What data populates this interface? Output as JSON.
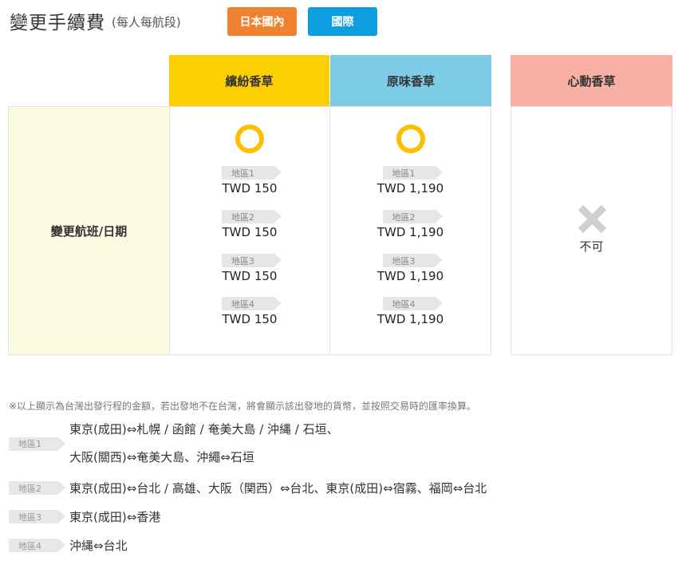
{
  "header": {
    "title": "變更手續費",
    "subtitle": "(每人每航段)",
    "tabs": [
      {
        "label": "日本國內",
        "color": "#f0812f"
      },
      {
        "label": "國際",
        "color": "#0e9ee0"
      }
    ]
  },
  "table": {
    "columns": [
      {
        "label": "繽紛香草",
        "color": "#fccf00"
      },
      {
        "label": "原味香草",
        "color": "#7dcbe6"
      },
      {
        "label": "心動香草",
        "color": "#f9b0a4"
      }
    ],
    "row_label": "變更航班/日期",
    "col1": {
      "icon": "circle-icon",
      "prices": [
        {
          "zone": "地區1",
          "value": "TWD 150"
        },
        {
          "zone": "地區2",
          "value": "TWD 150"
        },
        {
          "zone": "地區3",
          "value": "TWD 150"
        },
        {
          "zone": "地區4",
          "value": "TWD 150"
        }
      ]
    },
    "col2": {
      "icon": "circle-icon",
      "prices": [
        {
          "zone": "地區1",
          "value": "TWD 1,190"
        },
        {
          "zone": "地區2",
          "value": "TWD 1,190"
        },
        {
          "zone": "地區3",
          "value": "TWD 1,190"
        },
        {
          "zone": "地區4",
          "value": "TWD 1,190"
        }
      ]
    },
    "col3": {
      "icon": "x-icon",
      "text": "不可"
    }
  },
  "note": "※以上顯示為台灣出發行程的金額，若出發地不在台灣，將會顯示該出發地的貨幣，並按照交易時的匯率換算。",
  "legend": [
    {
      "zone": "地區1",
      "lines": [
        "東京(成田)⇔札幌 / 函館 / 奄美大島 / 沖縄 / 石垣、",
        "大阪(關西)⇔奄美大島、沖繩⇔石垣"
      ]
    },
    {
      "zone": "地區2",
      "lines": [
        "東京(成田)⇔台北 / 高雄、大阪（関西）⇔台北、東京(成田)⇔宿霧、福岡⇔台北"
      ]
    },
    {
      "zone": "地區3",
      "lines": [
        "東京(成田)⇔香港"
      ]
    },
    {
      "zone": "地區4",
      "lines": [
        "沖縄⇔台北"
      ]
    }
  ]
}
